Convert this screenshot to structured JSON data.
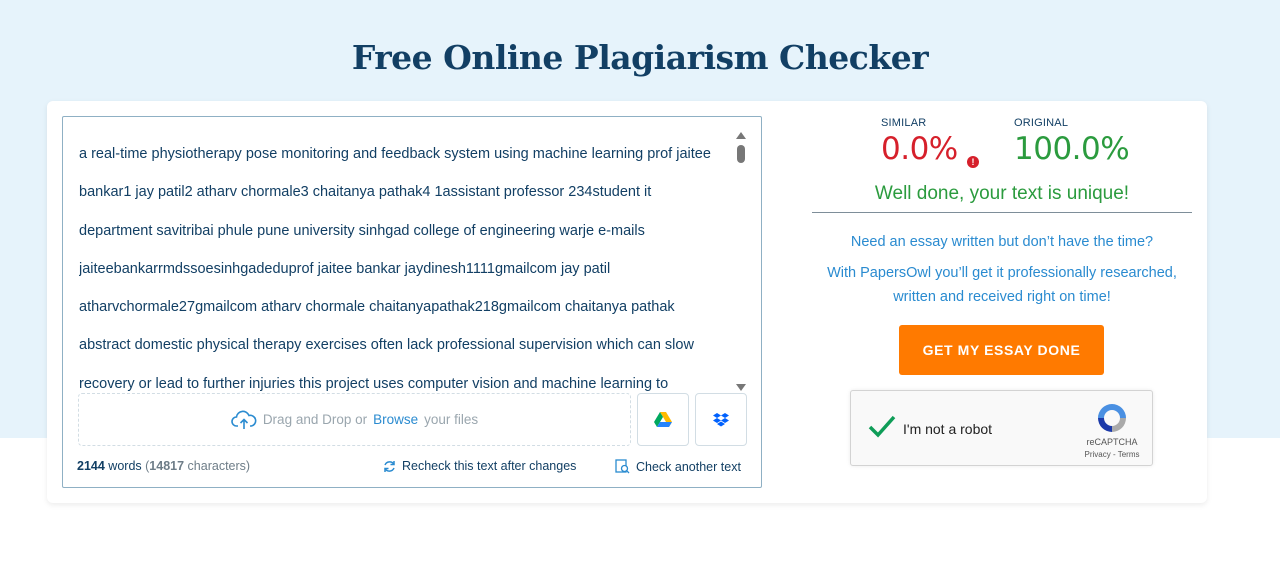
{
  "page": {
    "title": "Free Online Plagiarism Checker"
  },
  "editor": {
    "lines": [
      "a real-time physiotherapy pose monitoring and feedback system using machine learning prof jaitee",
      "bankar1 jay patil2 atharv chormale3 chaitanya pathak4 1assistant professor 234student it",
      "department savitribai phule pune university sinhgad college of engineering warje e-mails",
      "jaiteebankarrmdssoesinhgadeduprof jaitee bankar jaydinesh1111gmailcom jay patil",
      "atharvchormale27gmailcom atharv chormale chaitanyapathak218gmailcom chaitanya pathak",
      "abstract domestic physical therapy exercises often lack professional supervision which can slow",
      "recovery or lead to further injuries this project uses computer vision and machine learning to"
    ],
    "dropzone": {
      "prefix": "Drag and Drop or",
      "browse": "Browse",
      "suffix": "your files"
    },
    "word_count": "2144",
    "words_label": "words",
    "char_count": "14817",
    "chars_label": "characters",
    "recheck_label": "Recheck this text after changes",
    "check_another_label": "Check another text"
  },
  "results": {
    "similar_label": "SIMILAR",
    "similar_value": "0.0%",
    "original_label": "ORIGINAL",
    "original_value": "100.0%",
    "verdict": "Well done, your text is unique!",
    "promo_line1": "Need an essay written but don’t have the time?",
    "promo_line2": "With PapersOwl you’ll get it professionally researched, written and received right on time!",
    "cta_label": "GET MY ESSAY DONE"
  },
  "recaptcha": {
    "label": "I'm not a robot",
    "brand": "reCAPTCHA",
    "links": "Privacy - Terms"
  },
  "colors": {
    "title": "#123f64",
    "similar": "#d6202b",
    "original": "#2b9b3e",
    "link": "#2a8bd0",
    "cta": "#ff7a00"
  }
}
